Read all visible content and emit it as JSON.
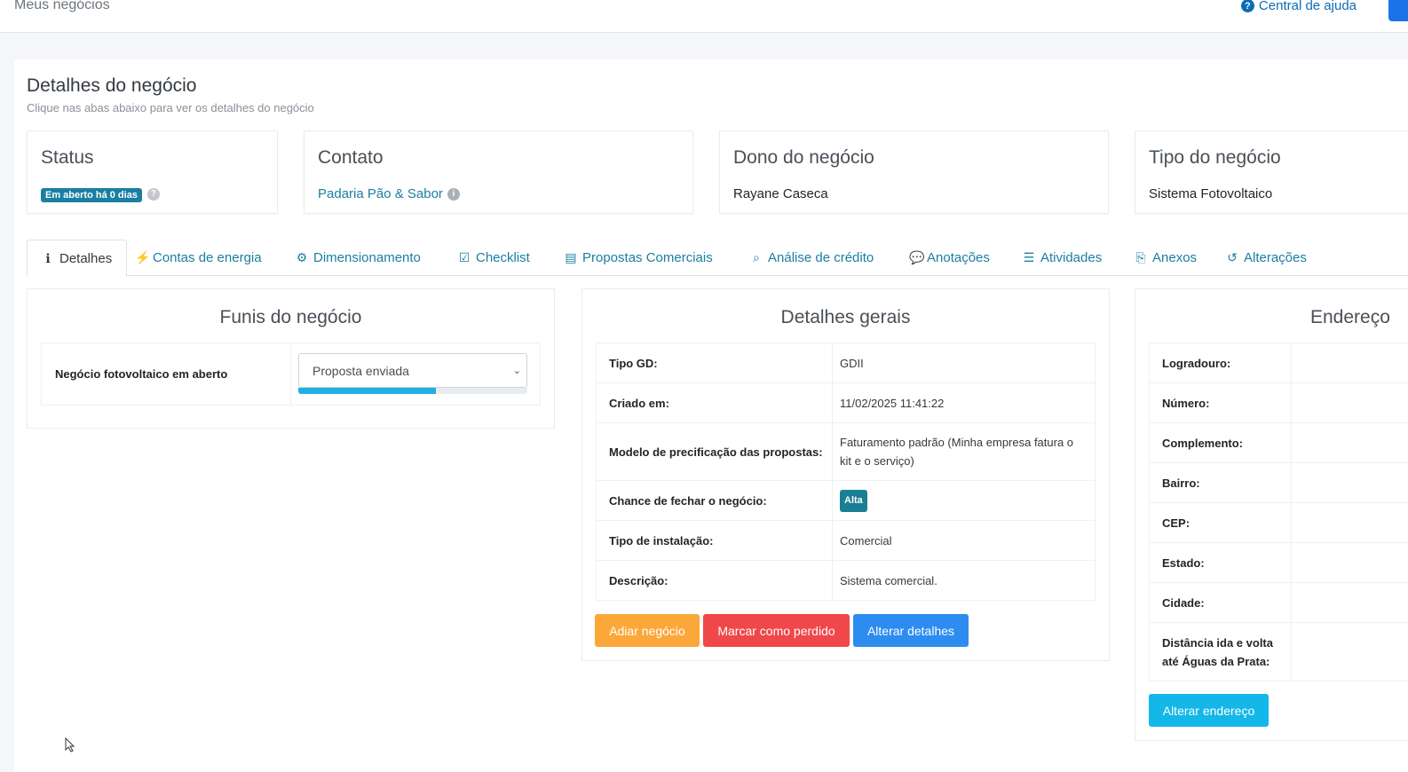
{
  "header": {
    "breadcrumb": "Meus negócios",
    "help_label": "Central de ajuda"
  },
  "page": {
    "title": "Detalhes do negócio",
    "subtitle": "Clique nas abas abaixo para ver os detalhes do negócio"
  },
  "cards": {
    "status": {
      "label": "Status",
      "badge": "Em aberto há 0 dias",
      "help": "?"
    },
    "contact": {
      "label": "Contato",
      "value": "Padaria Pão & Sabor",
      "info": "i"
    },
    "owner": {
      "label": "Dono do negócio",
      "value": "Rayane Caseca"
    },
    "type": {
      "label": "Tipo do negócio",
      "value": "Sistema Fotovoltaico"
    }
  },
  "tabs": [
    {
      "label": "Detalhes",
      "icon": "info-icon",
      "glyph": "ℹ"
    },
    {
      "label": "Contas de energia",
      "icon": "plug-icon",
      "glyph": "⚡"
    },
    {
      "label": "Dimensionamento",
      "icon": "cog-icon",
      "glyph": "⚙"
    },
    {
      "label": "Checklist",
      "icon": "checkbox-icon",
      "glyph": "☑"
    },
    {
      "label": "Propostas Comerciais",
      "icon": "document-icon",
      "glyph": "▤"
    },
    {
      "label": "Análise de crédito",
      "icon": "search-icon",
      "glyph": "⌕"
    },
    {
      "label": "Anotações",
      "icon": "comment-icon",
      "glyph": "💬"
    },
    {
      "label": "Atividades",
      "icon": "list-icon",
      "glyph": "☰"
    },
    {
      "label": "Anexos",
      "icon": "paperclip-icon",
      "glyph": "⎘"
    },
    {
      "label": "Alterações",
      "icon": "history-icon",
      "glyph": "↺"
    }
  ],
  "funnels": {
    "title": "Funis do negócio",
    "row_label": "Negócio fotovoltaico em aberto",
    "stage": "Proposta enviada",
    "progress": 0.6
  },
  "general": {
    "title": "Detalhes gerais",
    "rows": [
      {
        "key": "Tipo GD:",
        "value": "GDII"
      },
      {
        "key": "Criado em:",
        "value": "11/02/2025 11:41:22"
      },
      {
        "key": "Modelo de precificação das propostas:",
        "value": "Faturamento padrão (Minha empresa fatura o kit e o serviço)"
      },
      {
        "key": "Chance de fechar o negócio:",
        "value": "Alta"
      },
      {
        "key": "Tipo de instalação:",
        "value": "Comercial"
      },
      {
        "key": "Descrição:",
        "value": "Sistema comercial."
      }
    ],
    "buttons": {
      "postpone": "Adiar negócio",
      "lost": "Marcar como perdido",
      "edit": "Alterar detalhes"
    }
  },
  "address": {
    "title": "Endereço",
    "rows": [
      "Logradouro:",
      "Número:",
      "Complemento:",
      "Bairro:",
      "CEP:",
      "Estado:",
      "Cidade:",
      "Distância ida e volta até Águas da Prata:"
    ],
    "button": "Alterar endereço"
  },
  "colors": {
    "accent": "#1a7fa0",
    "warning": "#fca73a",
    "danger": "#f0474a",
    "primary": "#2d8cf0",
    "info": "#13b7e8"
  }
}
